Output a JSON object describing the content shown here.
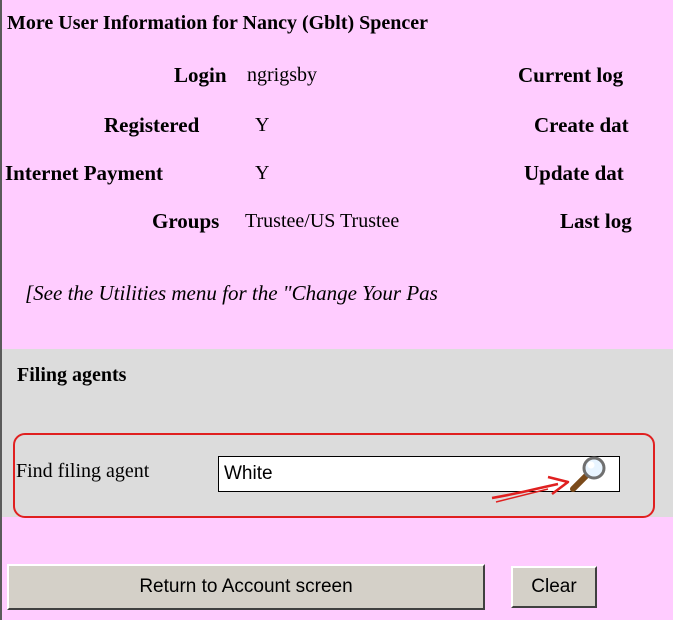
{
  "title": "More User Information for Nancy (Gblt) Spencer",
  "info_rows": [
    {
      "label": "Login",
      "value": "ngrigsby",
      "right_label": "Current log"
    },
    {
      "label": "Registered",
      "value": "Y",
      "right_label": "Create dat"
    },
    {
      "label": "Internet Payment",
      "value": "Y",
      "right_label": "Update dat"
    },
    {
      "label": "Groups",
      "value": "Trustee/US Trustee",
      "right_label": "Last log"
    }
  ],
  "note": "[See the Utilities menu for the \"Change Your Pas",
  "filing_agents": {
    "title": "Filing agents",
    "find_label": "Find filing agent",
    "search_value": "White",
    "search_icon": "magnifier-icon"
  },
  "buttons": {
    "return_label": "Return to Account screen",
    "clear_label": "Clear"
  },
  "colors": {
    "background": "#ffccff",
    "section_background": "#dcdcdc",
    "annotation_red": "#e02020"
  }
}
